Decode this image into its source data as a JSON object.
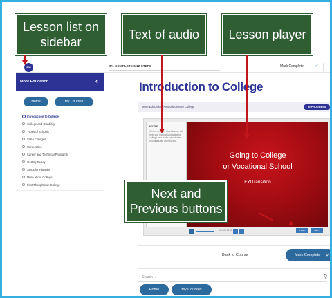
{
  "topbar": {
    "logo_text": "FYI",
    "progress_label": "0% COMPLETE 0/12 STEPS",
    "mark_complete_label": "Mark Complete",
    "check_icon": "check-icon"
  },
  "sidebar": {
    "title": "More Education",
    "collapse_icon": "chevron-left-icon",
    "home_label": "Home",
    "courses_label": "My Courses",
    "items": [
      {
        "label": "Introduction to College",
        "active": true
      },
      {
        "label": "College and Disability"
      },
      {
        "label": "Types of Schools"
      },
      {
        "label": "State Colleges"
      },
      {
        "label": "Universities"
      },
      {
        "label": "Career and Technical Programs"
      },
      {
        "label": "Getting Ready"
      },
      {
        "label": "Steps for Planning"
      },
      {
        "label": "More about College"
      },
      {
        "label": "First Thoughts on College"
      }
    ]
  },
  "main": {
    "title": "Introduction to College",
    "breadcrumb": "More Education > Introduction to College",
    "status": "IN PROGRESS",
    "player": {
      "notes_label": "NOTES",
      "notes_text": "Welcome. This short lesson will help you learn about going to college or a trade school after you graduate high school.",
      "slide_line1": "Going to College",
      "slide_line2": "or Vocational School",
      "slide_brand": "FYITransition",
      "time": "00:00 / 00:00",
      "prev_label": "PREV",
      "next_label": "NEXT"
    },
    "back_to_course": "Back to Course",
    "mark_complete": "Mark Complete",
    "search_placeholder": "Search ...",
    "home_label": "Home",
    "courses_label": "My Courses"
  },
  "callouts": {
    "sidebar": "Lesson list on sidebar",
    "audio": "Text of audio",
    "player": "Lesson player",
    "nav": "Next and Previous buttons"
  },
  "colors": {
    "brand_navy": "#2c3394",
    "button_blue": "#2c6a9e",
    "slide_red": "#b30f15",
    "callout_green": "#2f5e33",
    "arrow_red": "#c0161c",
    "frame_blue": "#35aee0"
  }
}
